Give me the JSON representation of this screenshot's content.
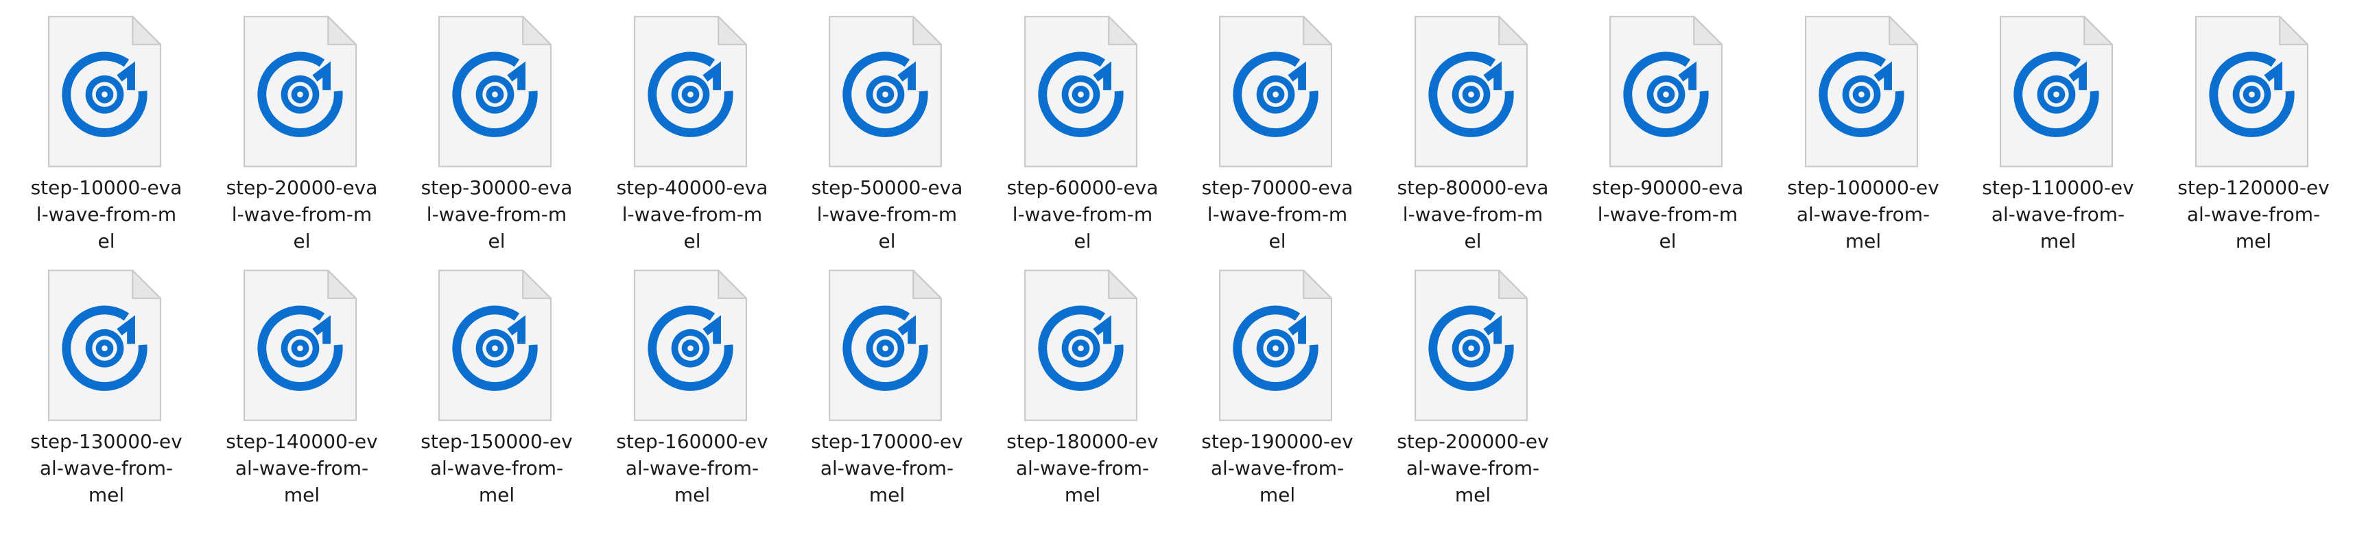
{
  "files": [
    {
      "label_lines": "step-10000-eva\nl-wave-from-m\nel",
      "icon": "audio-disc-file-icon"
    },
    {
      "label_lines": "step-20000-eva\nl-wave-from-m\nel",
      "icon": "audio-disc-file-icon"
    },
    {
      "label_lines": "step-30000-eva\nl-wave-from-m\nel",
      "icon": "audio-disc-file-icon"
    },
    {
      "label_lines": "step-40000-eva\nl-wave-from-m\nel",
      "icon": "audio-disc-file-icon"
    },
    {
      "label_lines": "step-50000-eva\nl-wave-from-m\nel",
      "icon": "audio-disc-file-icon"
    },
    {
      "label_lines": "step-60000-eva\nl-wave-from-m\nel",
      "icon": "audio-disc-file-icon"
    },
    {
      "label_lines": "step-70000-eva\nl-wave-from-m\nel",
      "icon": "audio-disc-file-icon"
    },
    {
      "label_lines": "step-80000-eva\nl-wave-from-m\nel",
      "icon": "audio-disc-file-icon"
    },
    {
      "label_lines": "step-90000-eva\nl-wave-from-m\nel",
      "icon": "audio-disc-file-icon"
    },
    {
      "label_lines": "step-100000-ev\nal-wave-from-\nmel",
      "icon": "audio-disc-file-icon"
    },
    {
      "label_lines": "step-110000-ev\nal-wave-from-\nmel",
      "icon": "audio-disc-file-icon"
    },
    {
      "label_lines": "step-120000-ev\nal-wave-from-\nmel",
      "icon": "audio-disc-file-icon"
    },
    {
      "label_lines": "step-130000-ev\nal-wave-from-\nmel",
      "icon": "audio-disc-file-icon"
    },
    {
      "label_lines": "step-140000-ev\nal-wave-from-\nmel",
      "icon": "audio-disc-file-icon"
    },
    {
      "label_lines": "step-150000-ev\nal-wave-from-\nmel",
      "icon": "audio-disc-file-icon"
    },
    {
      "label_lines": "step-160000-ev\nal-wave-from-\nmel",
      "icon": "audio-disc-file-icon"
    },
    {
      "label_lines": "step-170000-ev\nal-wave-from-\nmel",
      "icon": "audio-disc-file-icon"
    },
    {
      "label_lines": "step-180000-ev\nal-wave-from-\nmel",
      "icon": "audio-disc-file-icon"
    },
    {
      "label_lines": "step-190000-ev\nal-wave-from-\nmel",
      "icon": "audio-disc-file-icon"
    },
    {
      "label_lines": "step-200000-ev\nal-wave-from-\nmel",
      "icon": "audio-disc-file-icon"
    }
  ],
  "colors": {
    "accent": "#0a6fcf",
    "page_fill": "#f4f4f4",
    "page_border": "#c9c9c9",
    "fold_fill": "#e6e6e6",
    "label_text": "#1b1b1b"
  }
}
